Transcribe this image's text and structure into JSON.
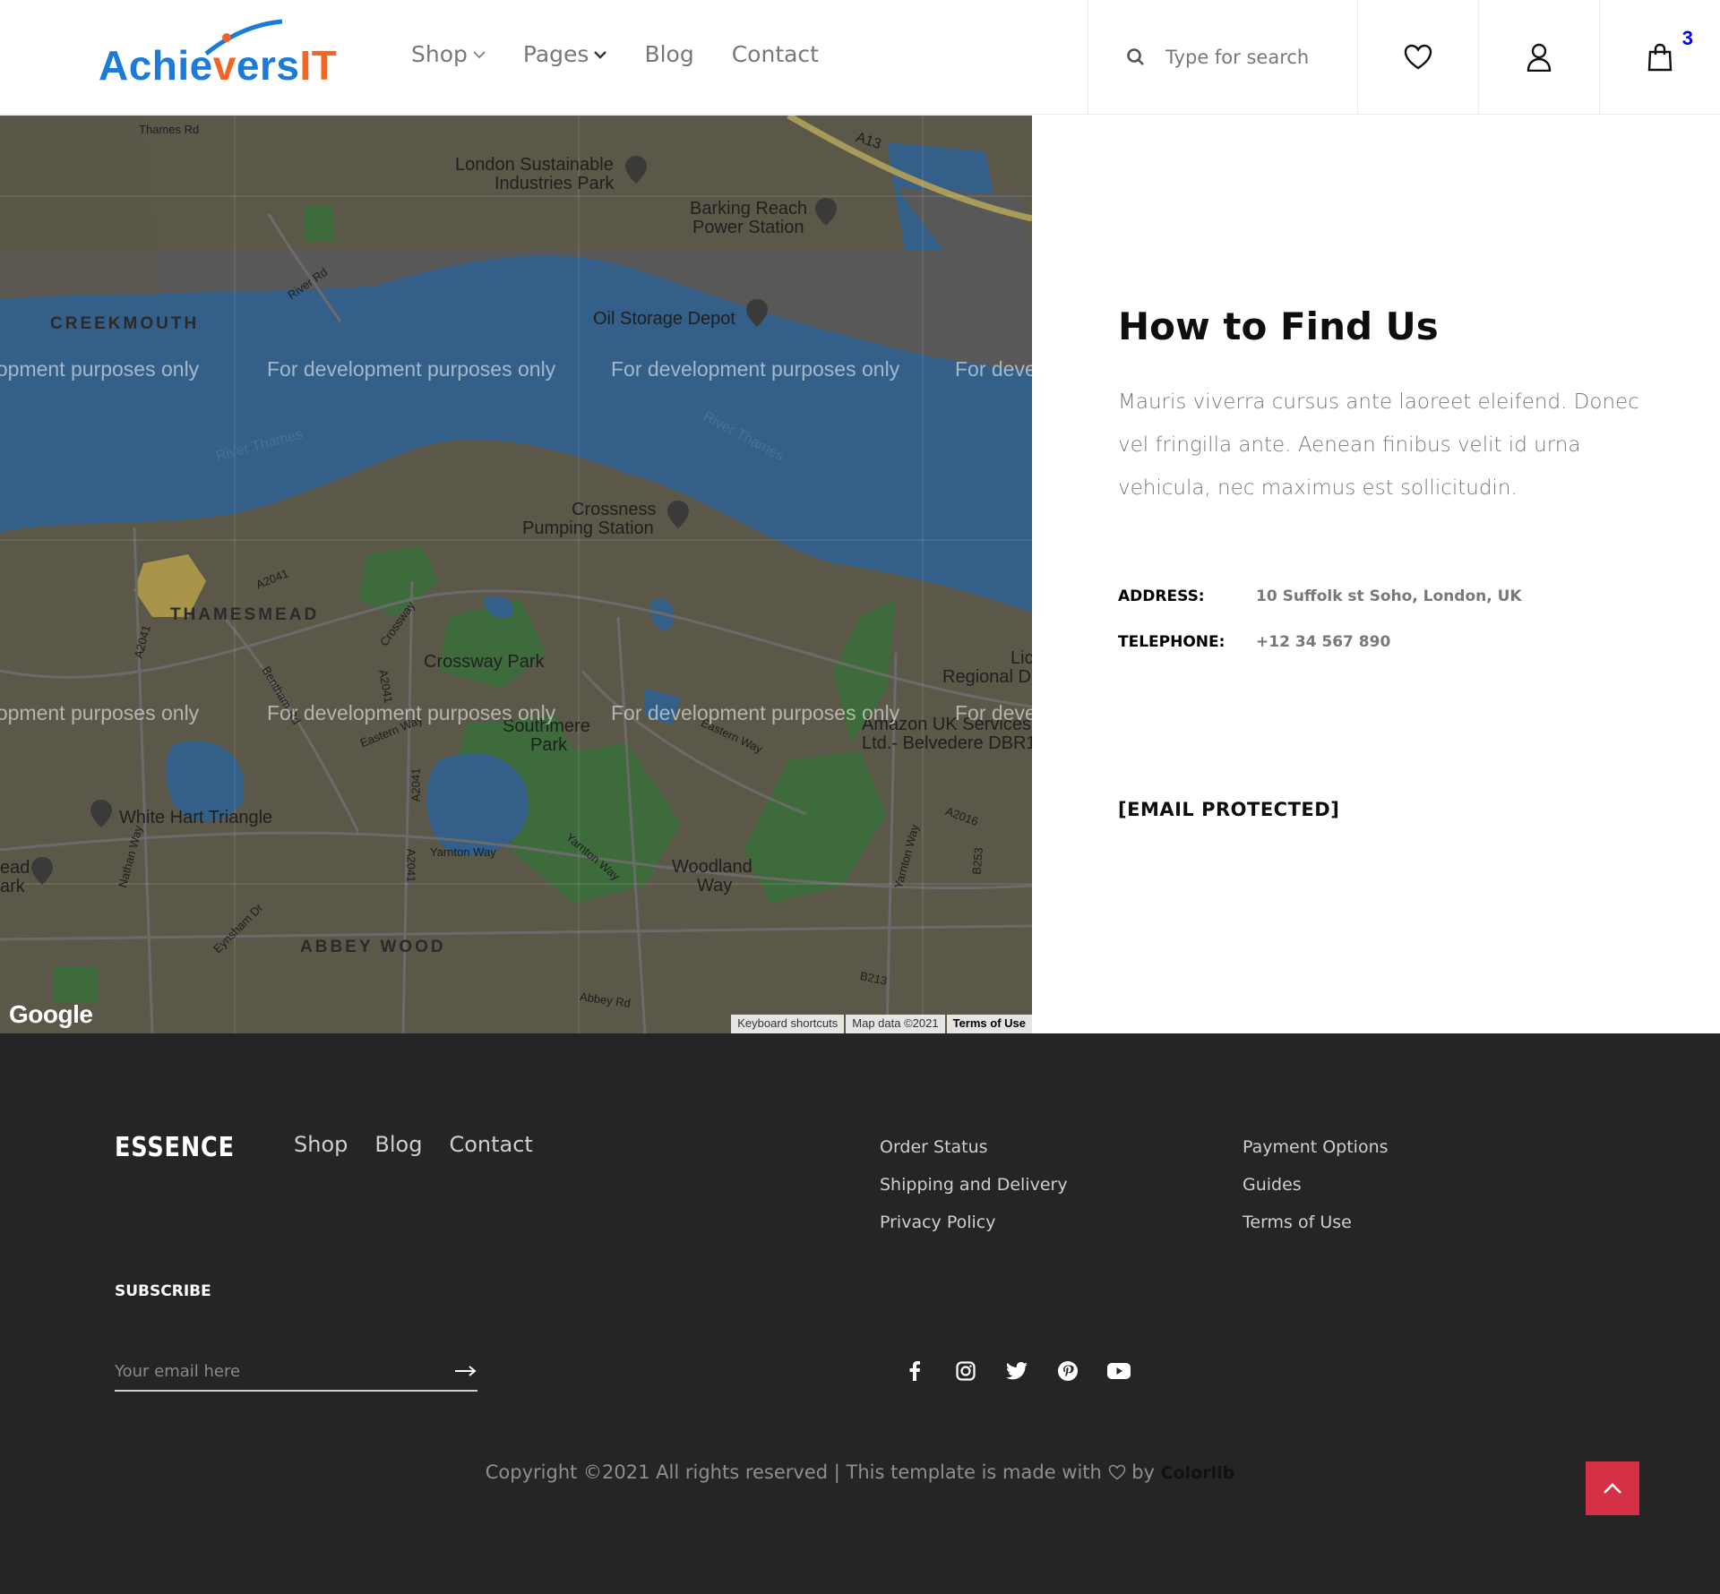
{
  "header": {
    "logo": {
      "part1": "Achie",
      "part2": "v",
      "part3": "ers",
      "part4": "IT"
    },
    "nav": [
      {
        "label": "Shop",
        "has_dropdown": true
      },
      {
        "label": "Pages",
        "has_dropdown": true
      },
      {
        "label": "Blog"
      },
      {
        "label": "Contact"
      }
    ],
    "search": {
      "placeholder": "Type for search",
      "icon": "search-icon"
    },
    "icons": [
      "heart-icon",
      "user-icon",
      "shopping-bag-icon"
    ],
    "cart_count": "3"
  },
  "map": {
    "dev_text": "For development purposes only",
    "labels": {
      "thames_rd": "Thames Rd",
      "london_sustainable_1": "London Sustainable",
      "london_sustainable_2": "Industries Park",
      "barking_1": "Barking Reach",
      "barking_2": "Power Station",
      "a13": "A13",
      "river_rd": "River Rd",
      "creekmouth": "CREEKMOUTH",
      "oil_storage": "Oil Storage Depot",
      "river_thames_1": "River Thames",
      "river_thames_2": "River Thames",
      "crossness_1": "Crossness",
      "crossness_2": "Pumping Station",
      "a2041_1": "A2041",
      "a2041_2": "A2041",
      "a2041_3": "A2041",
      "a2041_4": "A2041",
      "a2041_5": "A2041",
      "thamesmead": "THAMESMEAD",
      "crossway_rd": "Crossway",
      "crossway_park": "Crossway Park",
      "bentham_rd": "Bentham Rd",
      "eastern_way_1": "Eastern Way",
      "eastern_way_2": "Eastern Way",
      "southmere_1": "Southmere",
      "southmere_2": "Park",
      "amazon_1": "Amazon UK Services",
      "amazon_2": "Ltd.- Belvedere DBR1",
      "lic": "Lic",
      "regional": "Regional D",
      "white_hart": "White Hart Triangle",
      "nathan_way": "Nathan Way",
      "yarnton_1": "Yarnton Way",
      "yarnton_2": "Yarnton Way",
      "yarnton_3": "Yarnton Way",
      "woodland_1": "Woodland",
      "woodland_2": "Way",
      "a2016": "A2016",
      "b253": "B253",
      "b213": "B213",
      "eynsham": "Eynsham Dr",
      "abbey_wood": "ABBEY WOOD",
      "abbey_rd": "Abbey Rd",
      "ead": "ead",
      "ark": "ark"
    },
    "google": "Google",
    "footer": {
      "shortcuts": "Keyboard shortcuts",
      "data": "Map data ©2021",
      "terms": "Terms of Use"
    }
  },
  "contact": {
    "title": "How to Find Us",
    "description": "Mauris viverra cursus ante laoreet eleifend. Donec vel fringilla ante. Aenean finibus velit id urna vehicula, nec maximus est sollicitudin.",
    "address_label": "ADDRESS:",
    "address_value": "10 Suffolk st Soho, London, UK",
    "telephone_label": "TELEPHONE:",
    "telephone_value": "+12 34 567 890",
    "email": "[EMAIL PROTECTED]"
  },
  "footer": {
    "brand": "ESSENCE",
    "nav": [
      "Shop",
      "Blog",
      "Contact"
    ],
    "links_col1": [
      "Order Status",
      "Shipping and Delivery",
      "Privacy Policy"
    ],
    "links_col2": [
      "Payment Options",
      "Guides",
      "Terms of Use"
    ],
    "subscribe_title": "SUBSCRIBE",
    "subscribe_placeholder": "Your email here",
    "social": [
      "facebook-icon",
      "instagram-icon",
      "twitter-icon",
      "pinterest-icon",
      "youtube-icon"
    ],
    "copyright_prefix": "Copyright ©2021 All rights reserved | This template is made with",
    "copyright_by": "by",
    "copyright_brand": "Colorlib"
  }
}
